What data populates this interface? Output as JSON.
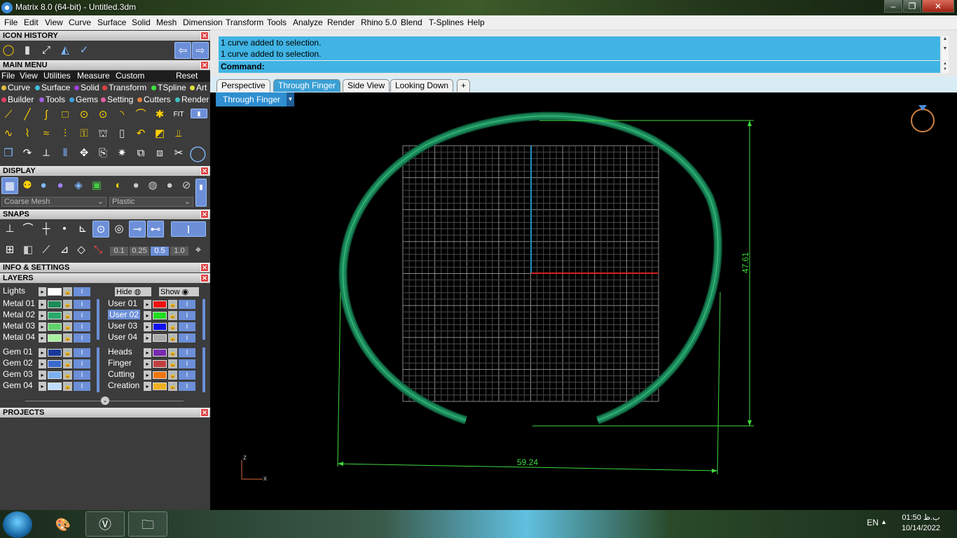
{
  "window": {
    "title": "Matrix 8.0 (64-bit) - Untitled.3dm",
    "min": "–",
    "max": "❐",
    "close": "✕"
  },
  "menu": [
    "File",
    "Edit",
    "View",
    "Curve",
    "Surface",
    "Solid",
    "Mesh",
    "Dimension",
    "Transform",
    "Tools",
    "Analyze",
    "Render",
    "Rhino 5.0",
    "Blend",
    "T-Splines",
    "Help"
  ],
  "panels": {
    "icon_history": "ICON HISTORY",
    "main_menu": "MAIN MENU",
    "display": "DISPLAY",
    "snaps": "SNAPS",
    "info": "INFO & SETTINGS",
    "layers": "LAYERS",
    "projects": "PROJECTS",
    "close": "✕"
  },
  "main_menu_tabs": [
    "File",
    "View",
    "Utilities",
    "Measure",
    "Custom",
    "Reset"
  ],
  "main_menu_row1": [
    "Curve",
    "Surface",
    "Solid",
    "Transform",
    "TSpline",
    "Art"
  ],
  "main_menu_row2": [
    "Builder",
    "Tools",
    "Gems",
    "Setting",
    "Cutters",
    "Render"
  ],
  "display": {
    "mesh": "Coarse Mesh",
    "material": "Plastic"
  },
  "snaps": {
    "values": [
      "0.1",
      "0.25",
      "0.5",
      "1.0"
    ]
  },
  "layers": {
    "lights": "Lights",
    "hide": "Hide",
    "show": "Show",
    "left": [
      {
        "name": "Metal 01",
        "color": "#1e8a5a"
      },
      {
        "name": "Metal 02",
        "color": "#2aa86a"
      },
      {
        "name": "Metal 03",
        "color": "#5fd36a"
      },
      {
        "name": "Metal 04",
        "color": "#a8f0a0"
      },
      {
        "name": "Gem 01",
        "color": "#1a3a9a"
      },
      {
        "name": "Gem 02",
        "color": "#3a6ad0"
      },
      {
        "name": "Gem 03",
        "color": "#7ab0f0"
      },
      {
        "name": "Gem 04",
        "color": "#c0dcff"
      }
    ],
    "right": [
      {
        "name": "User 01",
        "color": "#ee1111"
      },
      {
        "name": "User 02",
        "color": "#22dd22"
      },
      {
        "name": "User 03",
        "color": "#1111ee"
      },
      {
        "name": "User 04",
        "color": "#aaaaaa"
      },
      {
        "name": "Heads",
        "color": "#7a2ab0"
      },
      {
        "name": "Finger",
        "color": "#c04040"
      },
      {
        "name": "Cutting",
        "color": "#ee7711"
      },
      {
        "name": "Creation",
        "color": "#f0b020"
      }
    ]
  },
  "command": {
    "history": [
      "1 curve added to selection.",
      "1 curve added to selection."
    ],
    "prompt": "Command:"
  },
  "tabs": [
    "Perspective",
    "Through Finger",
    "Side View",
    "Looking Down"
  ],
  "tab_add": "+",
  "viewport": {
    "label": "Through Finger",
    "dim_height": "47.61",
    "dim_width": "59.24",
    "axis_z": "z",
    "axis_x": "x"
  },
  "taskbar": {
    "lang": "EN",
    "time": "01:50 ب.ظ",
    "date": "10/14/2022"
  },
  "colors": {
    "ring": "#1a8a5a",
    "dim": "#3fd83f",
    "grid": "#7a7a7a",
    "x_axis": "#d02020",
    "y_axis": "#2090c0"
  }
}
